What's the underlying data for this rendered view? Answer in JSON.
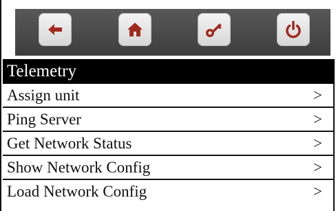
{
  "toolbar": {
    "buttons": [
      {
        "icon": "back-arrow-icon"
      },
      {
        "icon": "home-icon"
      },
      {
        "icon": "key-icon"
      },
      {
        "icon": "power-icon"
      }
    ]
  },
  "header": {
    "title": "Telemetry"
  },
  "menu": {
    "items": [
      {
        "label": "Assign unit",
        "arrow": ">"
      },
      {
        "label": "Ping Server",
        "arrow": ">"
      },
      {
        "label": "Get Network Status",
        "arrow": ">"
      },
      {
        "label": "Show Network Config",
        "arrow": ">"
      },
      {
        "label": "Load Network Config",
        "arrow": ">"
      }
    ]
  },
  "colors": {
    "header_bg": "#000000",
    "header_text": "#ffffff",
    "toolbar_bg": "#4a4a4a",
    "icon_red": "#a12a20"
  }
}
